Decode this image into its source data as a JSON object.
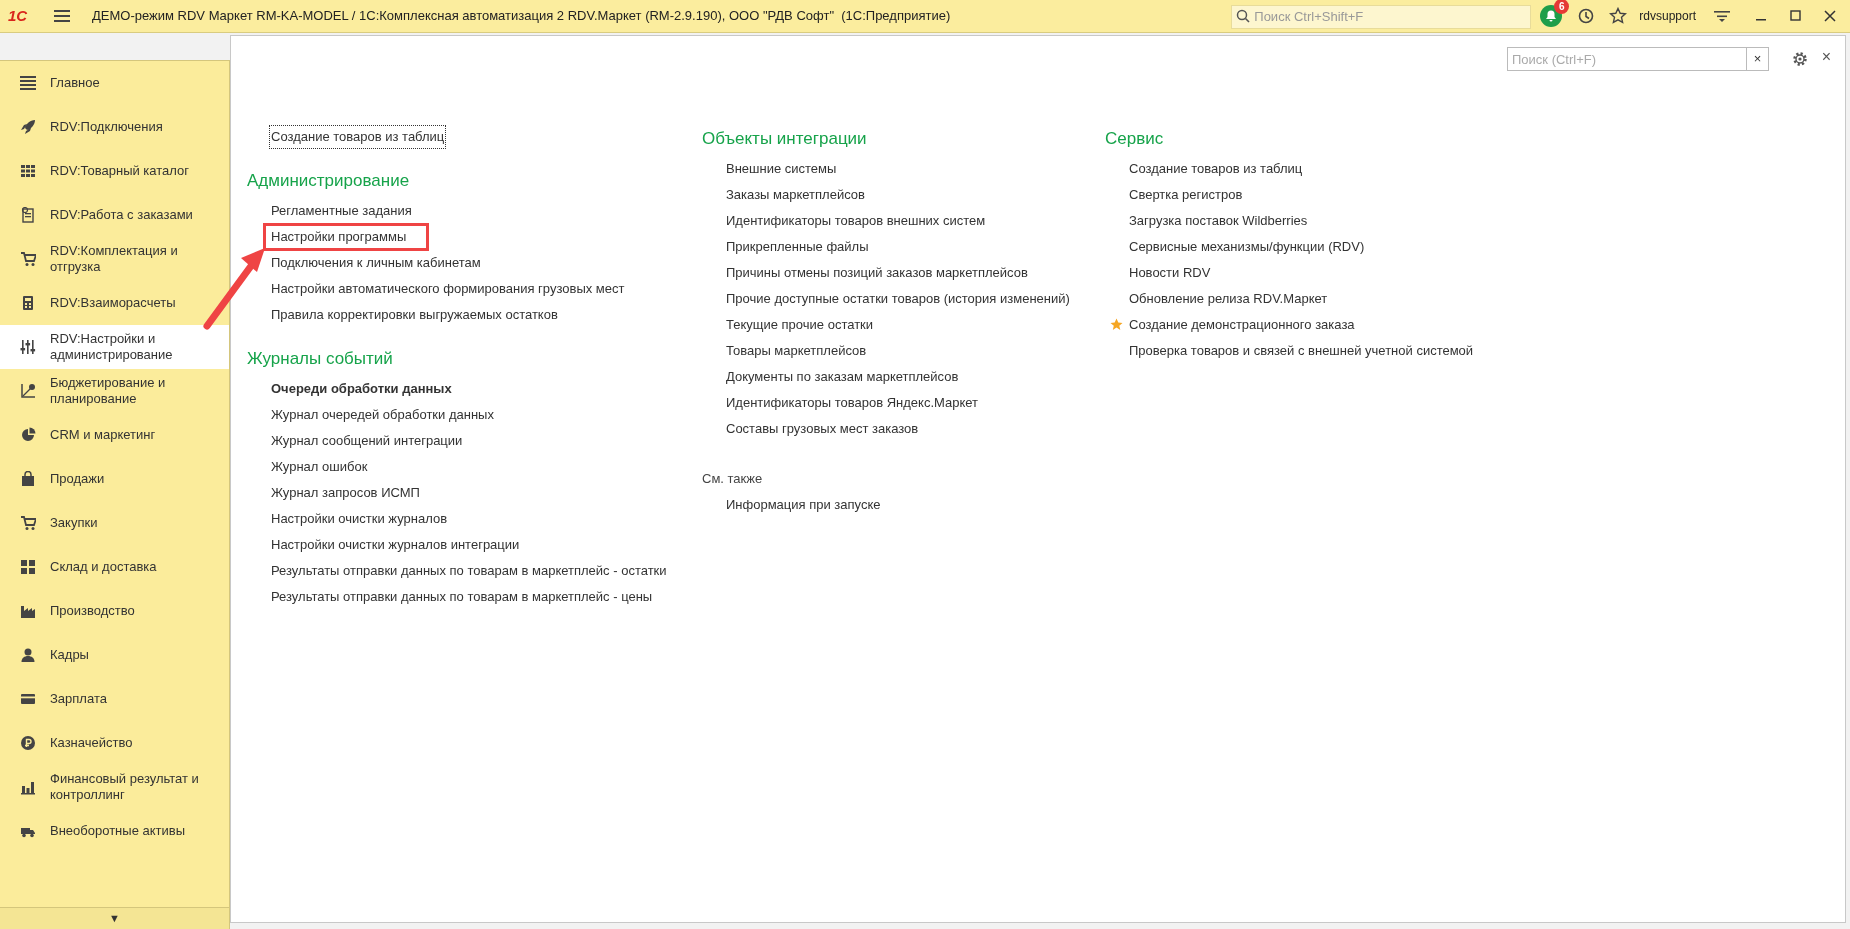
{
  "title_bar": {
    "logo": "1С",
    "title": "ДЕМО-режим RDV Маркет RM-KA-MODEL / 1С:Комплексная автоматизация 2 RDV.Маркет (RM-2.9.190), ООО \"РДВ Софт\"  (1С:Предприятие)",
    "search": {
      "placeholder": "Поиск Ctrl+Shift+F"
    },
    "notifications": "6",
    "user": "rdvsupport"
  },
  "sidebar": {
    "items": [
      {
        "label": "Главное",
        "selected": false
      },
      {
        "label": "RDV:Подключения",
        "selected": false
      },
      {
        "label": "RDV:Товарный каталог",
        "selected": false
      },
      {
        "label": "RDV:Работа с заказами",
        "selected": false
      },
      {
        "label": "RDV:Комплектация и отгрузка",
        "selected": false
      },
      {
        "label": "RDV:Взаиморасчеты",
        "selected": false
      },
      {
        "label": "RDV:Настройки и администрирование",
        "selected": true
      },
      {
        "label": "Бюджетирование и планирование",
        "selected": false
      },
      {
        "label": "CRM и маркетинг",
        "selected": false
      },
      {
        "label": "Продажи",
        "selected": false
      },
      {
        "label": "Закупки",
        "selected": false
      },
      {
        "label": "Склад и доставка",
        "selected": false
      },
      {
        "label": "Производство",
        "selected": false
      },
      {
        "label": "Кадры",
        "selected": false
      },
      {
        "label": "Зарплата",
        "selected": false
      },
      {
        "label": "Казначейство",
        "selected": false
      },
      {
        "label": "Финансовый результат и контроллинг",
        "selected": false
      },
      {
        "label": "Внеоборотные активы",
        "selected": false
      }
    ],
    "scroll_button": "▼"
  },
  "panel": {
    "search": {
      "placeholder": "Поиск (Ctrl+F)"
    },
    "clear_button": "×",
    "close_button": "×",
    "columns": [
      {
        "sections": [
          {
            "items": [
              {
                "label": "Создание товаров из таблиц",
                "focused": true
              }
            ]
          },
          {
            "heading": "Администрирование",
            "items": [
              {
                "label": "Регламентные задания"
              },
              {
                "label": "Настройки программы",
                "highlighted": true
              },
              {
                "label": "Подключения к личным кабинетам"
              },
              {
                "label": "Настройки автоматического формирования грузовых мест"
              },
              {
                "label": "Правила корректировки выгружаемых остатков"
              }
            ]
          },
          {
            "heading": "Журналы событий",
            "items": [
              {
                "label": "Очереди обработки данных",
                "bold": true
              },
              {
                "label": "Журнал очередей обработки данных"
              },
              {
                "label": "Журнал сообщений интеграции"
              },
              {
                "label": "Журнал ошибок"
              },
              {
                "label": "Журнал запросов ИСМП"
              },
              {
                "label": "Настройки очистки журналов"
              },
              {
                "label": "Настройки очистки журналов интеграции"
              },
              {
                "label": "Результаты отправки данных по товарам в маркетплейс - остатки"
              },
              {
                "label": "Результаты отправки данных по товарам в маркетплейс - цены"
              }
            ]
          }
        ]
      },
      {
        "sections": [
          {
            "heading": "Объекты интеграции",
            "items": [
              {
                "label": "Внешние системы"
              },
              {
                "label": "Заказы маркетплейсов"
              },
              {
                "label": "Идентификаторы товаров внешних систем"
              },
              {
                "label": "Прикрепленные файлы"
              },
              {
                "label": "Причины отмены позиций заказов маркетплейсов"
              },
              {
                "label": "Прочие доступные остатки товаров (история изменений)"
              },
              {
                "label": "Текущие прочие остатки"
              },
              {
                "label": "Товары маркетплейсов"
              },
              {
                "label": "Документы по заказам маркетплейсов"
              },
              {
                "label": "Идентификаторы товаров Яндекс.Маркет"
              },
              {
                "label": "Составы грузовых мест заказов"
              }
            ]
          },
          {
            "subheading": "См. также",
            "items": [
              {
                "label": "Информация при запуске"
              }
            ]
          }
        ]
      },
      {
        "sections": [
          {
            "heading": "Сервис",
            "items": [
              {
                "label": "Создание товаров из таблиц"
              },
              {
                "label": "Свертка регистров"
              },
              {
                "label": "Загрузка поставок Wildberries"
              },
              {
                "label": "Сервисные механизмы/функции (RDV)"
              },
              {
                "label": "Новости RDV"
              },
              {
                "label": "Обновление релиза RDV.Маркет"
              },
              {
                "label": "Создание демонстрационного заказа",
                "starred": true
              },
              {
                "label": "Проверка товаров и связей с внешней учетной системой"
              }
            ]
          }
        ]
      }
    ]
  }
}
